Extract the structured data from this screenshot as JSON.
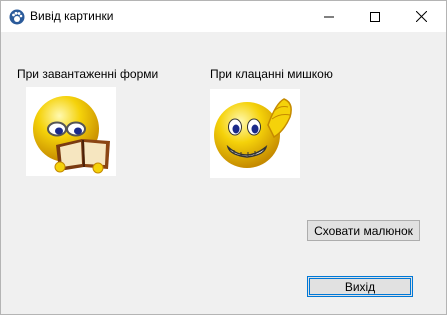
{
  "window": {
    "title": "Вивід картинки",
    "icon": "paw-app-icon",
    "controls": [
      "minimize-icon",
      "maximize-icon",
      "close-icon"
    ]
  },
  "labels": {
    "on_load": "При завантаженні форми",
    "on_click": "При клацанні мишкою"
  },
  "pictures": {
    "on_load": "reading-book-smiley",
    "on_click": "saluting-smiley"
  },
  "buttons": {
    "hide": "Сховати малюнок",
    "exit": "Вихід"
  },
  "colors": {
    "window_bg": "#f0f0f0",
    "titlebar_bg": "#ffffff",
    "button_bg": "#e1e1e1",
    "focus_border": "#0078d7",
    "smiley_yellow": "#f5d20a"
  }
}
